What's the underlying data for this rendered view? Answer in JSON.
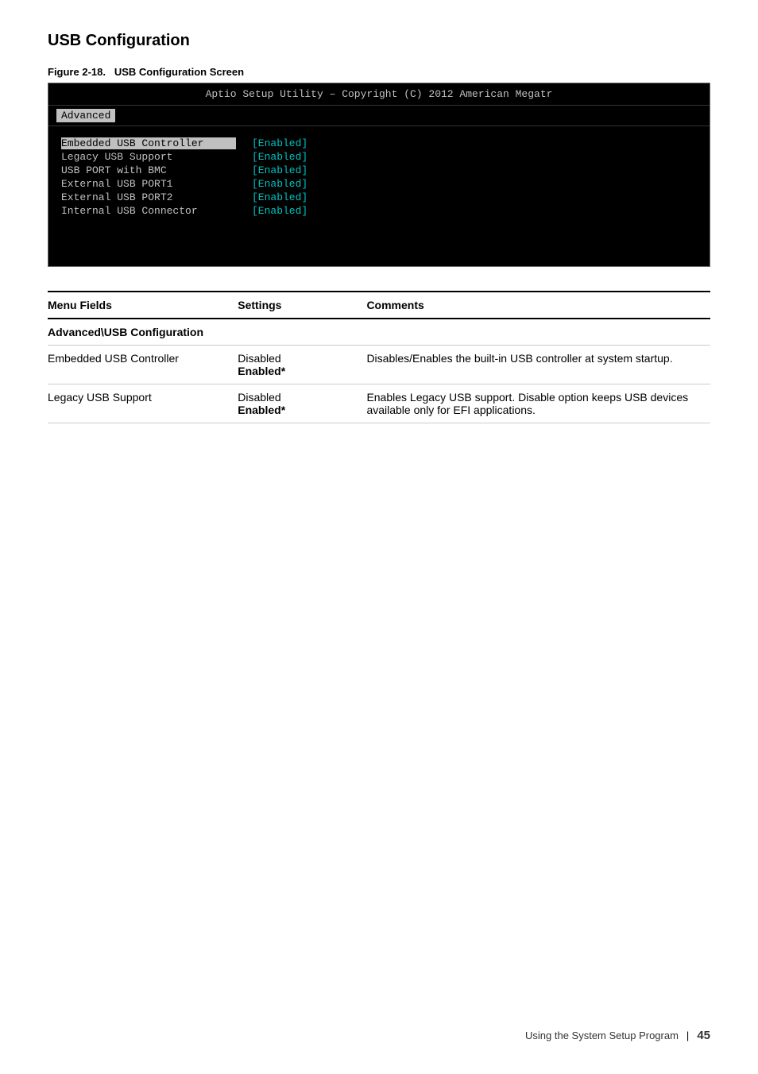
{
  "section": {
    "title": "USB Configuration"
  },
  "figure": {
    "label": "Figure 2-18.",
    "caption": "USB Configuration Screen"
  },
  "bios": {
    "header": "Aptio Setup Utility – Copyright (C) 2012 American Megatr",
    "nav_item": "Advanced",
    "rows": [
      {
        "label": "Embedded USB Controller",
        "value": "[Enabled]",
        "highlighted": true
      },
      {
        "label": "Legacy USB Support",
        "value": "[Enabled]",
        "highlighted": false
      },
      {
        "label": "USB PORT with BMC",
        "value": "[Enabled]",
        "highlighted": false
      },
      {
        "label": "External USB PORT1",
        "value": "[Enabled]",
        "highlighted": false
      },
      {
        "label": "External USB PORT2",
        "value": "[Enabled]",
        "highlighted": false
      },
      {
        "label": "Internal USB Connector",
        "value": "[Enabled]",
        "highlighted": false
      }
    ]
  },
  "table": {
    "columns": [
      "Menu Fields",
      "Settings",
      "Comments"
    ],
    "section_row": "Advanced\\USB Configuration",
    "rows": [
      {
        "field": "Embedded USB Controller",
        "settings": [
          "Disabled",
          "Enabled*"
        ],
        "comments": "Disables/Enables the built-in USB controller at system startup."
      },
      {
        "field": "Legacy USB Support",
        "settings": [
          "Disabled",
          "Enabled*"
        ],
        "comments": "Enables Legacy USB support. Disable option keeps USB devices available only for EFI applications."
      }
    ]
  },
  "footer": {
    "text": "Using the System Setup Program",
    "page": "45"
  }
}
